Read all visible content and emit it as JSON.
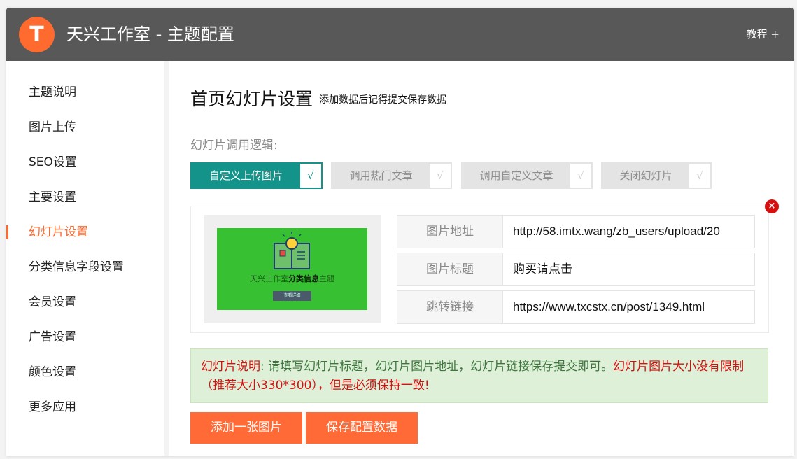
{
  "header": {
    "logo_letter": "T",
    "title": "天兴工作室 - 主题配置",
    "tutorial_link": "教程 +"
  },
  "sidebar": {
    "items": [
      {
        "label": "主题说明"
      },
      {
        "label": "图片上传"
      },
      {
        "label": "SEO设置"
      },
      {
        "label": "主要设置"
      },
      {
        "label": "幻灯片设置",
        "active": true
      },
      {
        "label": "分类信息字段设置"
      },
      {
        "label": "会员设置"
      },
      {
        "label": "广告设置"
      },
      {
        "label": "颜色设置"
      },
      {
        "label": "更多应用"
      }
    ]
  },
  "main": {
    "title": "首页幻灯片设置",
    "subtitle": "添加数据后记得提交保存数据",
    "logic_label": "幻灯片调用逻辑:",
    "options": [
      {
        "label": "自定义上传图片",
        "check": "√",
        "selected": true
      },
      {
        "label": "调用热门文章",
        "check": "√",
        "selected": false
      },
      {
        "label": "调用自定义文章",
        "check": "√",
        "selected": false
      },
      {
        "label": "关闭幻灯片",
        "check": "√",
        "selected": false
      }
    ],
    "slide": {
      "close_symbol": "×",
      "thumbnail": {
        "text_prefix": "天兴工作室",
        "text_bold": "分类信息",
        "text_suffix": "主题",
        "button": "查看详细"
      },
      "fields": [
        {
          "label": "图片地址",
          "value": "http://58.imtx.wang/zb_users/upload/20"
        },
        {
          "label": "图片标题",
          "value": "购买请点击"
        },
        {
          "label": "跳转链接",
          "value": "https://www.txcstx.cn/post/1349.html"
        }
      ]
    },
    "notice": {
      "lead": "幻灯片说明",
      "body": ": 请填写幻灯片标题，幻灯片图片地址，幻灯片链接保存提交即可。",
      "warning": "幻灯片图片大小没有限制（推荐大小330*300），但是必须保持一致!"
    },
    "buttons": {
      "add": "添加一张图片",
      "save": "保存配置数据"
    }
  },
  "colors": {
    "header_bg": "#585858",
    "accent_orange": "#ff6a2e",
    "selected_teal": "#14938a",
    "close_red": "#d6100f",
    "notice_green_bg": "#dff0d8"
  }
}
